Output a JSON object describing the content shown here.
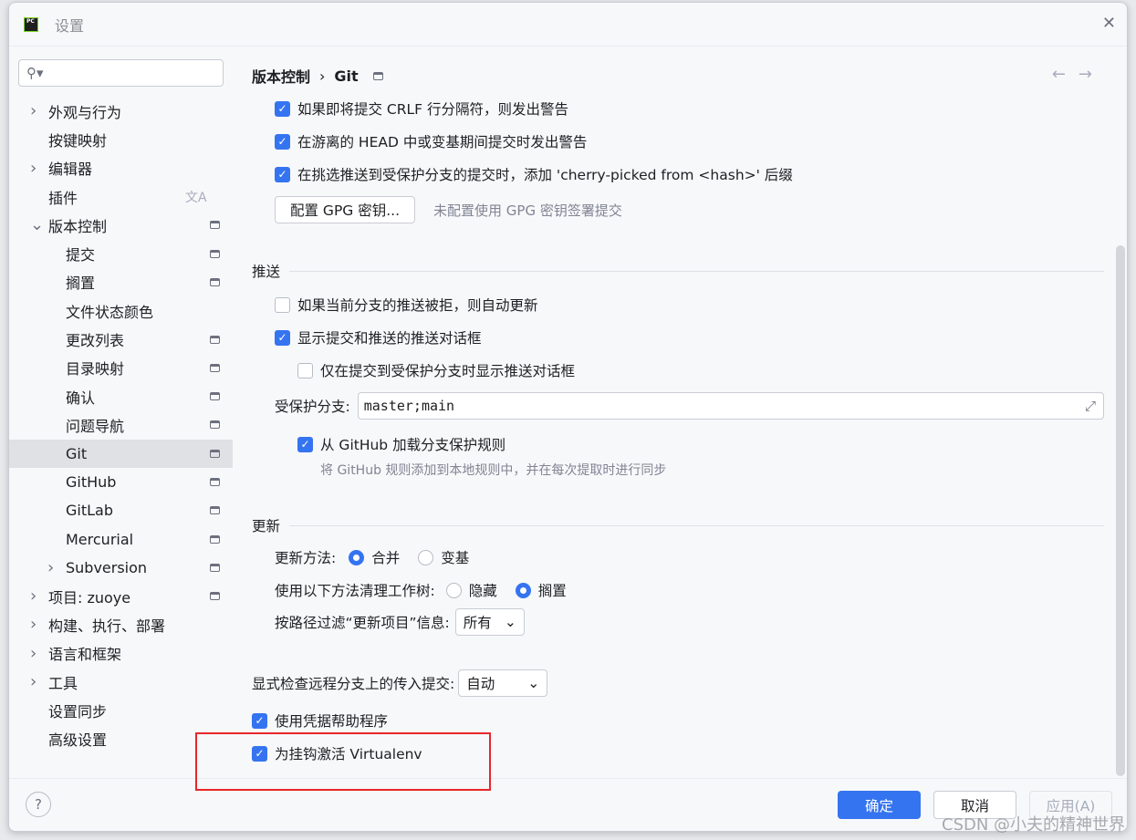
{
  "window": {
    "title": "设置"
  },
  "search": {
    "placeholder": ""
  },
  "sidebar": {
    "items": [
      {
        "label": "外观与行为",
        "expand": "collapsed",
        "level": 0
      },
      {
        "label": "按键映射",
        "level": 0
      },
      {
        "label": "编辑器",
        "expand": "collapsed",
        "level": 0
      },
      {
        "label": "插件",
        "level": 0,
        "icon": "translate-icon"
      },
      {
        "label": "版本控制",
        "expand": "expanded",
        "level": 0,
        "pin": true
      },
      {
        "label": "提交",
        "level": 1,
        "pin": true
      },
      {
        "label": "搁置",
        "level": 1,
        "pin": true
      },
      {
        "label": "文件状态颜色",
        "level": 1
      },
      {
        "label": "更改列表",
        "level": 1,
        "pin": true
      },
      {
        "label": "目录映射",
        "level": 1,
        "pin": true
      },
      {
        "label": "确认",
        "level": 1,
        "pin": true
      },
      {
        "label": "问题导航",
        "level": 1,
        "pin": true
      },
      {
        "label": "Git",
        "level": 1,
        "pin": true,
        "selected": true
      },
      {
        "label": "GitHub",
        "level": 1,
        "pin": true
      },
      {
        "label": "GitLab",
        "level": 1,
        "pin": true
      },
      {
        "label": "Mercurial",
        "level": 1,
        "pin": true
      },
      {
        "label": "Subversion",
        "level": 1,
        "expand": "collapsed",
        "pin": true
      },
      {
        "label": "项目: zuoye",
        "level": 0,
        "expand": "collapsed",
        "pin": true
      },
      {
        "label": "构建、执行、部署",
        "level": 0,
        "expand": "collapsed"
      },
      {
        "label": "语言和框架",
        "level": 0,
        "expand": "collapsed"
      },
      {
        "label": "工具",
        "level": 0,
        "expand": "collapsed"
      },
      {
        "label": "设置同步",
        "level": 0
      },
      {
        "label": "高级设置",
        "level": 0
      }
    ]
  },
  "breadcrumb": {
    "parent": "版本控制",
    "sep": "›",
    "current": "Git"
  },
  "commit": {
    "crlf": {
      "label": "如果即将提交 CRLF 行分隔符，则发出警告",
      "checked": true
    },
    "detached": {
      "label": "在游离的 HEAD 中或变基期间提交时发出警告",
      "checked": true
    },
    "cherry": {
      "label": "在挑选推送到受保护分支的提交时，添加 'cherry-picked from <hash>' 后缀",
      "checked": true
    },
    "gpg_button": "配置 GPG 密钥...",
    "gpg_hint": "未配置使用 GPG 密钥签署提交"
  },
  "push": {
    "title": "推送",
    "auto_update": {
      "label": "如果当前分支的推送被拒，则自动更新",
      "checked": false
    },
    "show_dialog": {
      "label": "显示提交和推送的推送对话框",
      "checked": true
    },
    "only_protected": {
      "label": "仅在提交到受保护分支时显示推送对话框",
      "checked": false
    },
    "protected_label": "受保护分支:",
    "protected_value": "master;main",
    "github_rules": {
      "label": "从 GitHub 加载分支保护规则",
      "checked": true
    },
    "github_hint": "将 GitHub 规则添加到本地规则中，并在每次提取时进行同步"
  },
  "update": {
    "title": "更新",
    "method_label": "更新方法:",
    "method_options": [
      {
        "label": "合并",
        "selected": true
      },
      {
        "label": "变基",
        "selected": false
      }
    ],
    "clean_label": "使用以下方法清理工作树:",
    "clean_options": [
      {
        "label": "隐藏",
        "selected": false
      },
      {
        "label": "搁置",
        "selected": true
      }
    ],
    "filter_label": "按路径过滤“更新项目”信息:",
    "filter_value": "所有"
  },
  "incoming": {
    "label": "显式检查远程分支上的传入提交:",
    "value": "自动"
  },
  "credential": {
    "label": "使用凭据帮助程序",
    "checked": true
  },
  "virtualenv": {
    "label": "为挂钩激活 Virtualenv",
    "checked": true
  },
  "footer": {
    "ok": "确定",
    "cancel": "取消",
    "apply": "应用(A)",
    "help": "?"
  },
  "watermark": "CSDN @小夫的精神世界",
  "colors": {
    "accent": "#3574f0",
    "highlight": "#e8262a"
  }
}
